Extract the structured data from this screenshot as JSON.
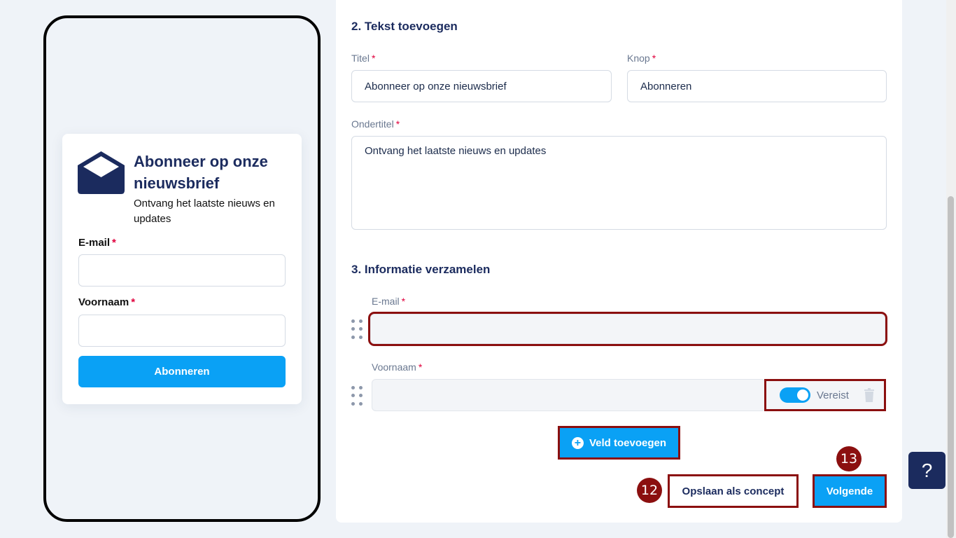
{
  "preview": {
    "title": "Abonneer op onze nieuwsbrief",
    "subtitle": "Ontvang het laatste nieuws en updates",
    "fields": [
      {
        "label": "E-mail",
        "required_mark": "*"
      },
      {
        "label": "Voornaam",
        "required_mark": "*"
      }
    ],
    "button_label": "Abonneren",
    "icon": "envelope-open-icon"
  },
  "section_text": {
    "title": "2. Tekst toevoegen",
    "title_label": "Titel",
    "title_value": "Abonneer op onze nieuwsbrief",
    "button_label": "Knop",
    "button_value": "Abonneren",
    "subtitle_label": "Ondertitel",
    "subtitle_value": "Ontvang het laatste nieuws en updates",
    "required_mark": "*"
  },
  "section_info": {
    "title": "3. Informatie verzamelen",
    "fields": [
      {
        "label": "E-mail",
        "required_mark": "*"
      },
      {
        "label": "Voornaam",
        "required_mark": "*",
        "toggle_label": "Vereist",
        "toggle_on": true
      }
    ],
    "add_field_label": "Veld toevoegen"
  },
  "actions": {
    "draft_label": "Opslaan als concept",
    "next_label": "Volgende",
    "badge_draft": "12",
    "badge_next": "13"
  },
  "help": {
    "label": "?"
  },
  "colors": {
    "accent": "#0aa1f5",
    "navy": "#1b2b5e",
    "highlight": "#8b0f0f",
    "required": "#e0003c"
  }
}
